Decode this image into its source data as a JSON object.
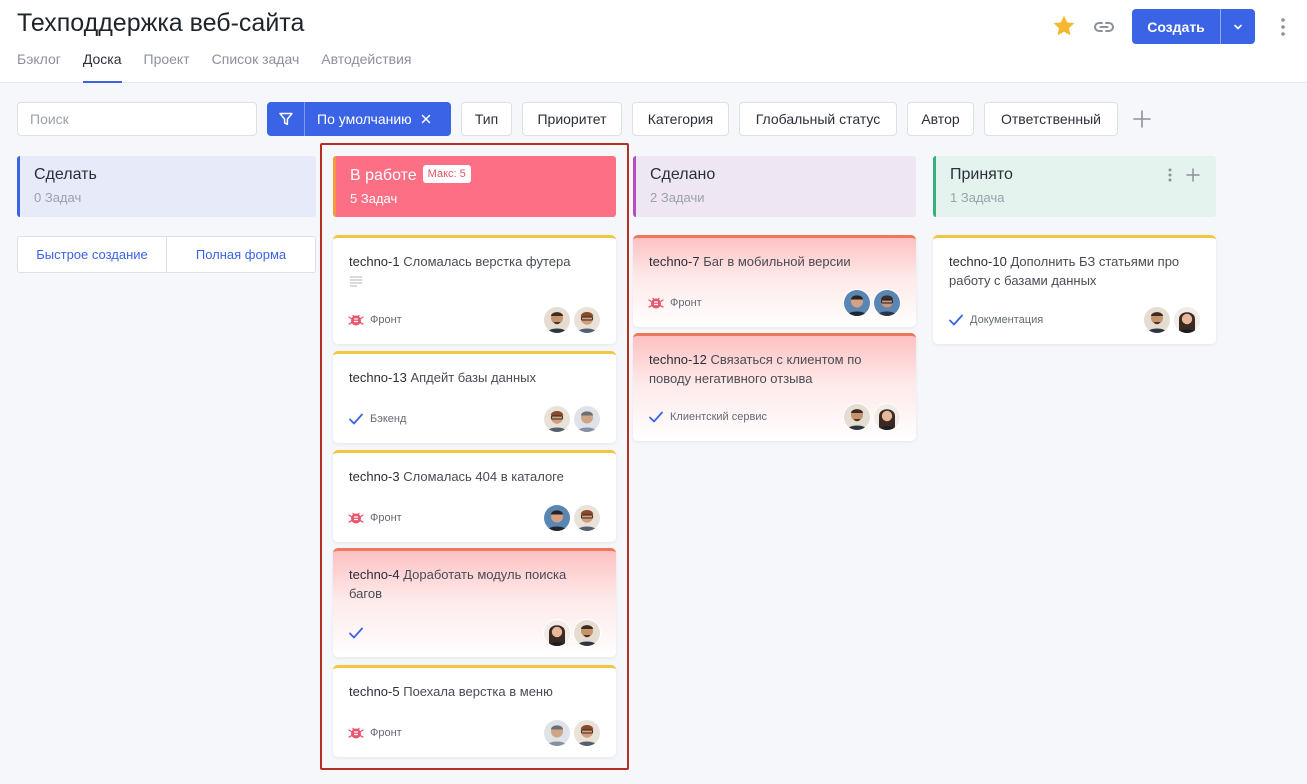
{
  "header": {
    "title": "Техподдержка веб-сайта",
    "tabs": [
      {
        "label": "Бэклог"
      },
      {
        "label": "Доска",
        "active": true
      },
      {
        "label": "Проект"
      },
      {
        "label": "Список задач"
      },
      {
        "label": "Автодействия"
      }
    ],
    "create_label": "Создать"
  },
  "filters": {
    "search_placeholder": "Поиск",
    "preset_label": "По умолчанию",
    "chips": [
      "Тип",
      "Приоритет",
      "Категория",
      "Глобальный статус",
      "Автор",
      "Ответственный"
    ]
  },
  "quick_actions": {
    "quick_create": "Быстрое создание",
    "full_form": "Полная форма"
  },
  "columns": [
    {
      "title": "Сделать",
      "count": "0 Задач",
      "color": "#3b63e6",
      "bg": "#e7eaf8"
    },
    {
      "title": "В работе",
      "count": "5 Задач",
      "max_badge": "Макс: 5",
      "color": "#f49a3c",
      "bg": "#fd6f84"
    },
    {
      "title": "Сделано",
      "count": "2 Задачи",
      "color": "#b34fc1",
      "bg": "#efe6f4"
    },
    {
      "title": "Принято",
      "count": "1 Задача",
      "color": "#33b27a",
      "bg": "#e4f3ee"
    }
  ],
  "cards": [
    {
      "key": "techno-1",
      "title": "Сломалась верстка футера",
      "category": "Фронт",
      "icon": "bug-icon",
      "hot": false
    },
    {
      "key": "techno-13",
      "title": "Апдейт базы данных",
      "category": "Бэкенд",
      "icon": "check-icon",
      "hot": false
    },
    {
      "key": "techno-3",
      "title": "Сломалась 404 в каталоге",
      "category": "Фронт",
      "icon": "bug-icon",
      "hot": false
    },
    {
      "key": "techno-4",
      "title": "Доработать модуль поиска багов",
      "category": "",
      "icon": "check-icon",
      "hot": true
    },
    {
      "key": "techno-5",
      "title": "Поехала верстка в меню",
      "category": "Фронт",
      "icon": "bug-icon",
      "hot": false
    },
    {
      "key": "techno-7",
      "title": "Баг в мобильной версии",
      "category": "Фронт",
      "icon": "bug-icon",
      "hot": true
    },
    {
      "key": "techno-12",
      "title": "Связаться с клиентом по поводу негативного отзыва",
      "category": "Клиентский сервис",
      "icon": "check-icon",
      "hot": true
    },
    {
      "key": "techno-10",
      "title": "Дополнить БЗ статьями про работу с базами данных",
      "category": "Документация",
      "icon": "check-icon",
      "hot": false
    }
  ],
  "colors": {
    "accent": "#3b63e6",
    "star": "#f5b82e",
    "bug": "#e8566d",
    "highlight_frame": "#b52f23"
  }
}
